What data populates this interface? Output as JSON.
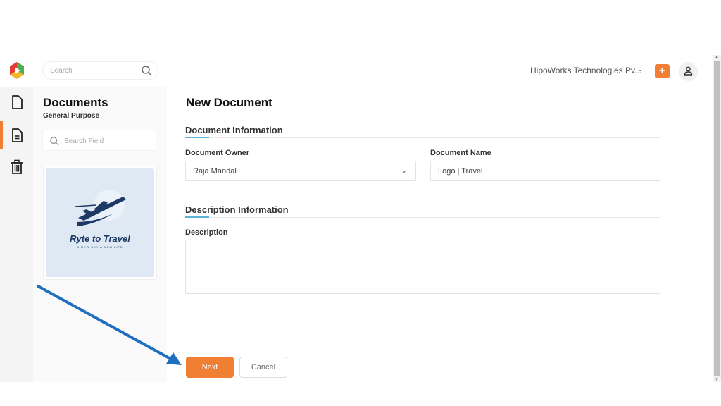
{
  "topbar": {
    "search_placeholder": "Search",
    "org_name": "HipoWorks Technologies Pv...",
    "org_chevron": "⌄",
    "add_label": "+"
  },
  "rail": {
    "items": [
      {
        "icon": "file-icon"
      },
      {
        "icon": "document-icon",
        "active": true
      },
      {
        "icon": "trash-icon"
      }
    ]
  },
  "panel": {
    "title": "Documents",
    "subtitle": "General Purpose",
    "search_placeholder": "Search Field",
    "card": {
      "brand": "Ryte to Travel",
      "tagline": "A NEW SKY A NEW LIFE"
    }
  },
  "form": {
    "title": "New Document",
    "section1": "Document Information",
    "owner_label": "Document Owner",
    "owner_value": "Raja Mandal",
    "name_label": "Document Name",
    "name_value": "Logo | Travel",
    "section2": "Description Information",
    "description_label": "Description",
    "description_value": "",
    "next_label": "Next",
    "cancel_label": "Cancel"
  },
  "colors": {
    "accent": "#f07f34",
    "annotation_arrow": "#1f6fbf",
    "section_accent": "#5bb3d6"
  }
}
